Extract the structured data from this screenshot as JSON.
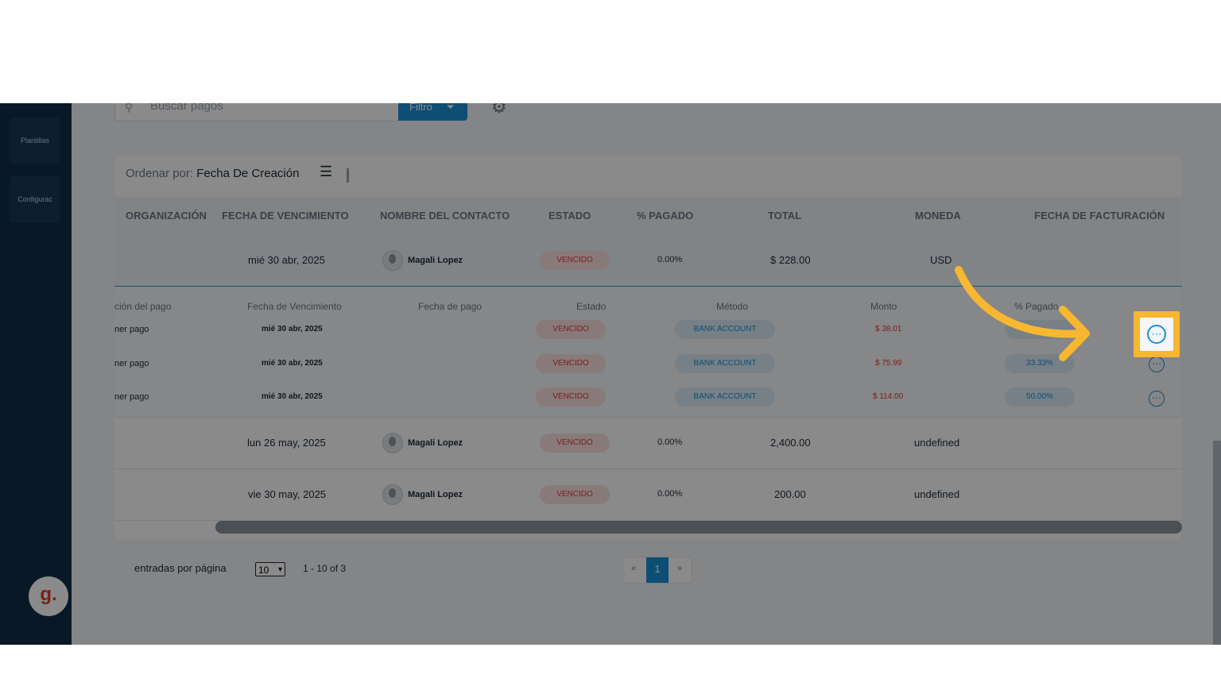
{
  "sidebar": {
    "items": [
      {
        "label": "Plantillas"
      },
      {
        "label": "Configurac"
      }
    ],
    "logo_letter": "g."
  },
  "toolbar": {
    "search_placeholder": "Buscar pagos",
    "filter_label": "Filtro"
  },
  "sort": {
    "prefix": "Ordenar por:",
    "value": "Fecha De Creación"
  },
  "table": {
    "headers": [
      "ORGANIZACIÓN",
      "FECHA DE VENCIMIENTO",
      "NOMBRE DEL CONTACTO",
      "ESTADO",
      "% PAGADO",
      "TOTAL",
      "MONEDA",
      "FECHA DE FACTURACIÓN"
    ],
    "rows": [
      {
        "due": "mié 30 abr, 2025",
        "contact": "Magali Lopez",
        "status": "VENCIDO",
        "paid": "0.00%",
        "total": "$ 228.00",
        "currency": "USD"
      },
      {
        "due": "lun 26 may, 2025",
        "contact": "Magali Lopez",
        "status": "VENCIDO",
        "paid": "0.00%",
        "total": "2,400.00",
        "currency": "undefined"
      },
      {
        "due": "vie 30 may, 2025",
        "contact": "Magali Lopez",
        "status": "VENCIDO",
        "paid": "0.00%",
        "total": "200.00",
        "currency": "undefined"
      }
    ]
  },
  "subtable": {
    "headers": [
      "ción del pago",
      "Fecha de Vencimiento",
      "Fecha de pago",
      "Estado",
      "Método",
      "Monto",
      "% Pagado"
    ],
    "rows": [
      {
        "desc": "ner pago",
        "due": "mié 30 abr, 2025",
        "status": "VENCIDO",
        "method": "BANK ACCOUNT",
        "amount": "$ 38.01",
        "pct": ""
      },
      {
        "desc": "ner pago",
        "due": "mié 30 abr, 2025",
        "status": "VENCIDO",
        "method": "BANK ACCOUNT",
        "amount": "$ 75.99",
        "pct": "33.33%"
      },
      {
        "desc": "ner pago",
        "due": "mié 30 abr, 2025",
        "status": "VENCIDO",
        "method": "BANK ACCOUNT",
        "amount": "$ 114.00",
        "pct": "50.00%"
      }
    ]
  },
  "footer": {
    "entries_label": "entradas por página",
    "per_page": "10",
    "range": "1 - 10 of 3",
    "current_page": "1",
    "prev_label": "«",
    "next_label": "»"
  },
  "colors": {
    "highlight": "#f7b731",
    "accent": "#1a90d9",
    "status_red": "#e53935",
    "sidebar": "#0f2d46"
  },
  "icons": {
    "more": "more-horizontal-icon",
    "search": "search-icon",
    "filter": "filter-icon",
    "gear": "gear-icon",
    "sort": "sort-lines-icon"
  }
}
